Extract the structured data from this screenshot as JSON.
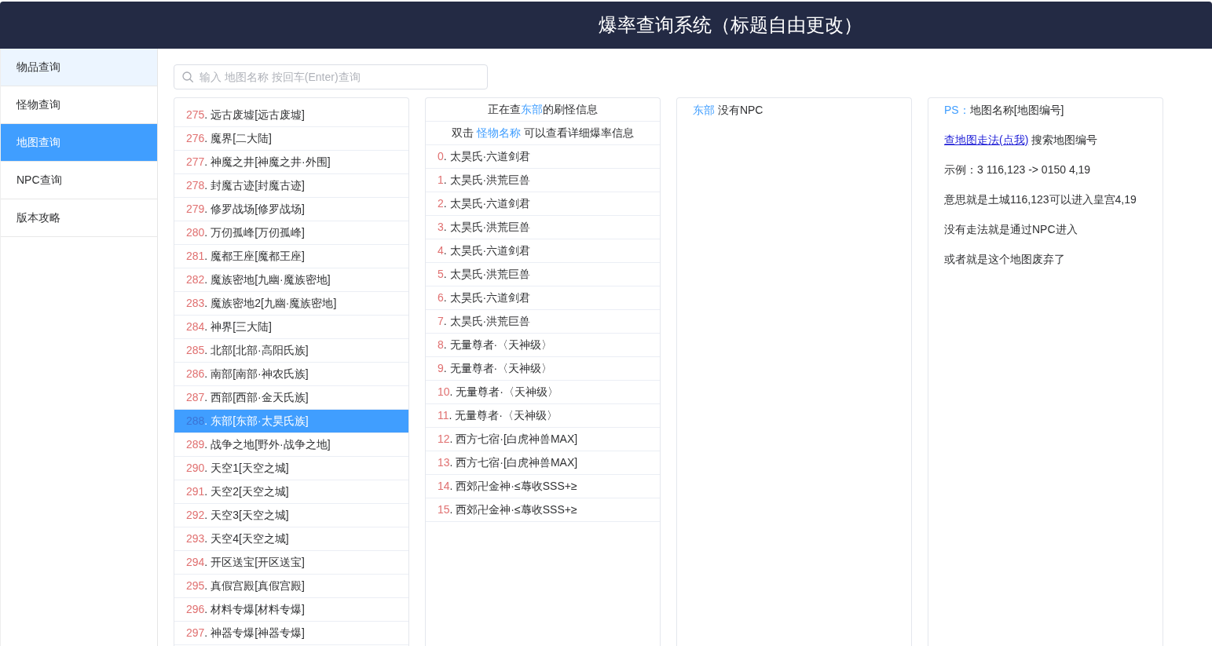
{
  "header": {
    "title": "爆率查询系统（标题自由更改）"
  },
  "sidebar": {
    "items": [
      {
        "label": "物品查询",
        "selected": false,
        "highlighted": true
      },
      {
        "label": "怪物查询",
        "selected": false,
        "highlighted": false
      },
      {
        "label": "地图查询",
        "selected": true,
        "highlighted": false
      },
      {
        "label": "NPC查询",
        "selected": false,
        "highlighted": false
      },
      {
        "label": "版本攻略",
        "selected": false,
        "highlighted": false
      }
    ]
  },
  "search": {
    "placeholder": "输入 地图名称 按回车(Enter)查询"
  },
  "map_list": {
    "items": [
      {
        "number": "275",
        "label": ". 远古废墟[远古废墟]",
        "selected": false
      },
      {
        "number": "276",
        "label": ". 魔界[二大陆]",
        "selected": false
      },
      {
        "number": "277",
        "label": ". 神魔之井[神魔之井·外围]",
        "selected": false
      },
      {
        "number": "278",
        "label": ". 封魔古迹[封魔古迹]",
        "selected": false
      },
      {
        "number": "279",
        "label": ". 修罗战场[修罗战场]",
        "selected": false
      },
      {
        "number": "280",
        "label": ". 万仞孤峰[万仞孤峰]",
        "selected": false
      },
      {
        "number": "281",
        "label": ". 魔都王座[魔都王座]",
        "selected": false
      },
      {
        "number": "282",
        "label": ". 魔族密地[九幽·魔族密地]",
        "selected": false
      },
      {
        "number": "283",
        "label": ". 魔族密地2[九幽·魔族密地]",
        "selected": false
      },
      {
        "number": "284",
        "label": ". 神界[三大陆]",
        "selected": false
      },
      {
        "number": "285",
        "label": ". 北部[北部·高阳氏族]",
        "selected": false
      },
      {
        "number": "286",
        "label": ". 南部[南部·神农氏族]",
        "selected": false
      },
      {
        "number": "287",
        "label": ". 西部[西部·金天氏族]",
        "selected": false
      },
      {
        "number": "288",
        "label": ". 东部[东部·太昊氏族]",
        "selected": true
      },
      {
        "number": "289",
        "label": ". 战争之地[野外·战争之地]",
        "selected": false
      },
      {
        "number": "290",
        "label": ". 天空1[天空之城]",
        "selected": false
      },
      {
        "number": "291",
        "label": ". 天空2[天空之城]",
        "selected": false
      },
      {
        "number": "292",
        "label": ". 天空3[天空之城]",
        "selected": false
      },
      {
        "number": "293",
        "label": ". 天空4[天空之城]",
        "selected": false
      },
      {
        "number": "294",
        "label": ". 开区送宝[开区送宝]",
        "selected": false
      },
      {
        "number": "295",
        "label": ". 真假宫殿[真假宫殿]",
        "selected": false
      },
      {
        "number": "296",
        "label": ". 材料专爆[材料专爆]",
        "selected": false
      },
      {
        "number": "297",
        "label": ". 神器专爆[神器专爆]",
        "selected": false
      }
    ]
  },
  "monster_panel": {
    "heading": {
      "before": "正在查",
      "map": "东部",
      "after": "的刷怪信息"
    },
    "hint": {
      "before": "双击",
      "highlight": "怪物名称",
      "after": "可以查看详细爆率信息"
    },
    "monsters": [
      {
        "number": "0",
        "label": ". 太昊氏·六道剑君"
      },
      {
        "number": "1",
        "label": ". 太昊氏·洪荒巨兽"
      },
      {
        "number": "2",
        "label": ". 太昊氏·六道剑君"
      },
      {
        "number": "3",
        "label": ". 太昊氏·洪荒巨兽"
      },
      {
        "number": "4",
        "label": ". 太昊氏·六道剑君"
      },
      {
        "number": "5",
        "label": ". 太昊氏·洪荒巨兽"
      },
      {
        "number": "6",
        "label": ". 太昊氏·六道剑君"
      },
      {
        "number": "7",
        "label": ". 太昊氏·洪荒巨兽"
      },
      {
        "number": "8",
        "label": ". 无量尊者·〈天神级〉"
      },
      {
        "number": "9",
        "label": ". 无量尊者·〈天神级〉"
      },
      {
        "number": "10",
        "label": ". 无量尊者·〈天神级〉"
      },
      {
        "number": "11",
        "label": ". 无量尊者·〈天神级〉"
      },
      {
        "number": "12",
        "label": ". 西方七宿·[白虎神兽MAX]"
      },
      {
        "number": "13",
        "label": ". 西方七宿·[白虎神兽MAX]"
      },
      {
        "number": "14",
        "label": ". 西郊卍金神·≤蓐收SSS+≥"
      },
      {
        "number": "15",
        "label": ". 西郊卍金神·≤蓐收SSS+≥"
      }
    ]
  },
  "npc_panel": {
    "map": "东部",
    "message": "没有NPC"
  },
  "help_panel": {
    "lines": [
      {
        "kind": "note",
        "prefix": "PS：",
        "text": "地图名称[地图编号]"
      },
      {
        "kind": "link",
        "link": "查地图走法(点我)",
        "text": "搜索地图编号"
      },
      {
        "kind": "text",
        "text": "示例：3 116,123 -> 0150 4,19"
      },
      {
        "kind": "text",
        "text": "意思就是土城116,123可以进入皇宫4,19"
      },
      {
        "kind": "text",
        "text": "没有走法就是通过NPC进入"
      },
      {
        "kind": "text",
        "text": "或者就是这个地图废弃了"
      }
    ]
  }
}
